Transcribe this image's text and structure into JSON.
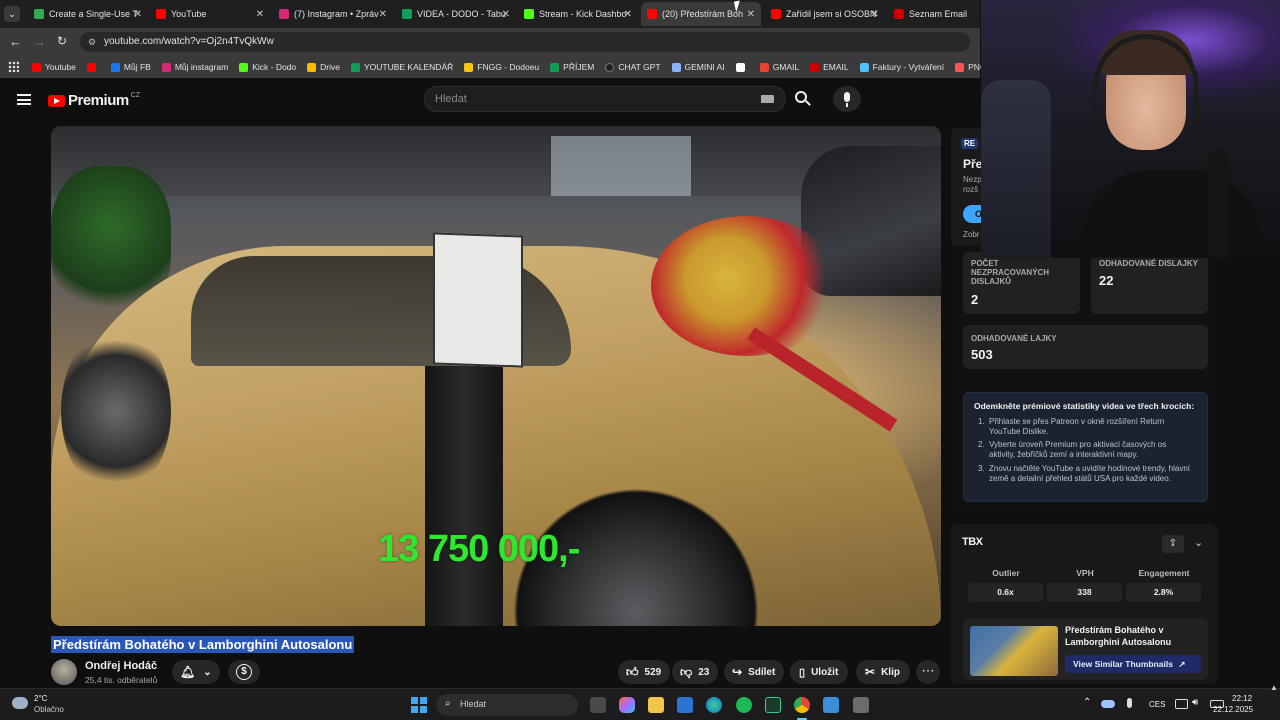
{
  "browser": {
    "tabs": [
      {
        "label": "Create a Single-Use T",
        "color": "#34a853"
      },
      {
        "label": "YouTube",
        "color": "#ff0000"
      },
      {
        "label": "(7) Instagram • Zpráv",
        "color": "#d62976"
      },
      {
        "label": "VIDEA - DODO - Tabu",
        "color": "#0f9d58"
      },
      {
        "label": "Stream - Kick Dashbo",
        "color": "#53fc18"
      },
      {
        "label": "(20) Předstírám Boh",
        "color": "#ff0000"
      },
      {
        "label": "Zařídil jsem si OSOBN",
        "color": "#ff0000"
      },
      {
        "label": "Seznam Email",
        "color": "#cc0000"
      }
    ],
    "url": "youtube.com/watch?v=Oj2n4TvQkWw",
    "bookmarks": [
      {
        "label": "Youtube",
        "color": "#ff0000"
      },
      {
        "label": "",
        "color": "#ff0000"
      },
      {
        "label": "Můj FB",
        "color": "#1877f2"
      },
      {
        "label": "Můj instagram",
        "color": "#d62976"
      },
      {
        "label": "Kick - Dodo",
        "color": "#53fc18"
      },
      {
        "label": "Drive",
        "color": "#fbbc04"
      },
      {
        "label": "YOUTUBE KALENDÁŘ",
        "color": "#0f9d58"
      },
      {
        "label": "FNGG - Dodoeu",
        "color": "#f5c518"
      },
      {
        "label": "PŘÍJEM",
        "color": "#0f9d58"
      },
      {
        "label": "CHAT GPT",
        "color": "#222222"
      },
      {
        "label": "GEMINI AI",
        "color": "#8ab4f8"
      },
      {
        "label": "",
        "color": "#ffffff"
      },
      {
        "label": "GMAIL",
        "color": "#ea4335"
      },
      {
        "label": "EMAIL",
        "color": "#cc0000"
      },
      {
        "label": "Faktury - Vytváření",
        "color": "#4fc3f7"
      },
      {
        "label": "PNG to PDF",
        "color": "#ff5252"
      }
    ]
  },
  "youtube": {
    "logo_text": "Premium",
    "region": "CZ",
    "search_placeholder": "Hledat",
    "video": {
      "overlay_price": "13 750 000,-",
      "title": "Předstírám Bohatého v Lamborghini Autosalonu",
      "channel": "Ondřej Hodáč",
      "subscribers": "25,4 tis. odběratelů",
      "likes": "529",
      "dislikes": "23",
      "share": "Sdílet",
      "save": "Uložit",
      "clip": "Klip"
    }
  },
  "panel": {
    "promo": {
      "badge": "RE",
      "title": "Pře",
      "desc1": "Nezp",
      "desc2": "rozš",
      "btn": "O",
      "foot": "Zobr"
    },
    "stats": [
      {
        "label": "POČET NEZPRACOVANÝCH DISLAJKŮ",
        "value": "2"
      },
      {
        "label": "ODHADOVANÉ DISLAJKY",
        "value": "22"
      },
      {
        "label": "ODHADOVANÉ LAJKY",
        "value": "503"
      }
    ],
    "premium": {
      "heading": "Odemkněte prémiové statistiky videa ve třech krocích:",
      "steps": [
        "Přihlaste se přes Patreon v okně rozšíření Return YouTube Dislike.",
        "Vyberte úroveň Premium pro aktivaci časových os aktivity, žebříčků zemí a interaktivní mapy.",
        "Znovu načtěte YouTube a uvidíte hodinové trendy, hlavní země a detailní přehled států USA pro každé video."
      ]
    },
    "metrics": {
      "logo": "TBX",
      "cols": [
        {
          "label": "Outlier",
          "value": "0.6x"
        },
        {
          "label": "VPH",
          "value": "338"
        },
        {
          "label": "Engagement",
          "value": "2.8%"
        }
      ],
      "thumb_title": "Předstírám Bohatého v Lamborghini Autosalonu",
      "similar_btn": "View Similar Thumbnails"
    }
  },
  "taskbar": {
    "weather_temp": "2°C",
    "weather_desc": "Oblačno",
    "search": "Hledat",
    "lang": "CES",
    "time": "22:12",
    "date": "22.12.2025"
  }
}
